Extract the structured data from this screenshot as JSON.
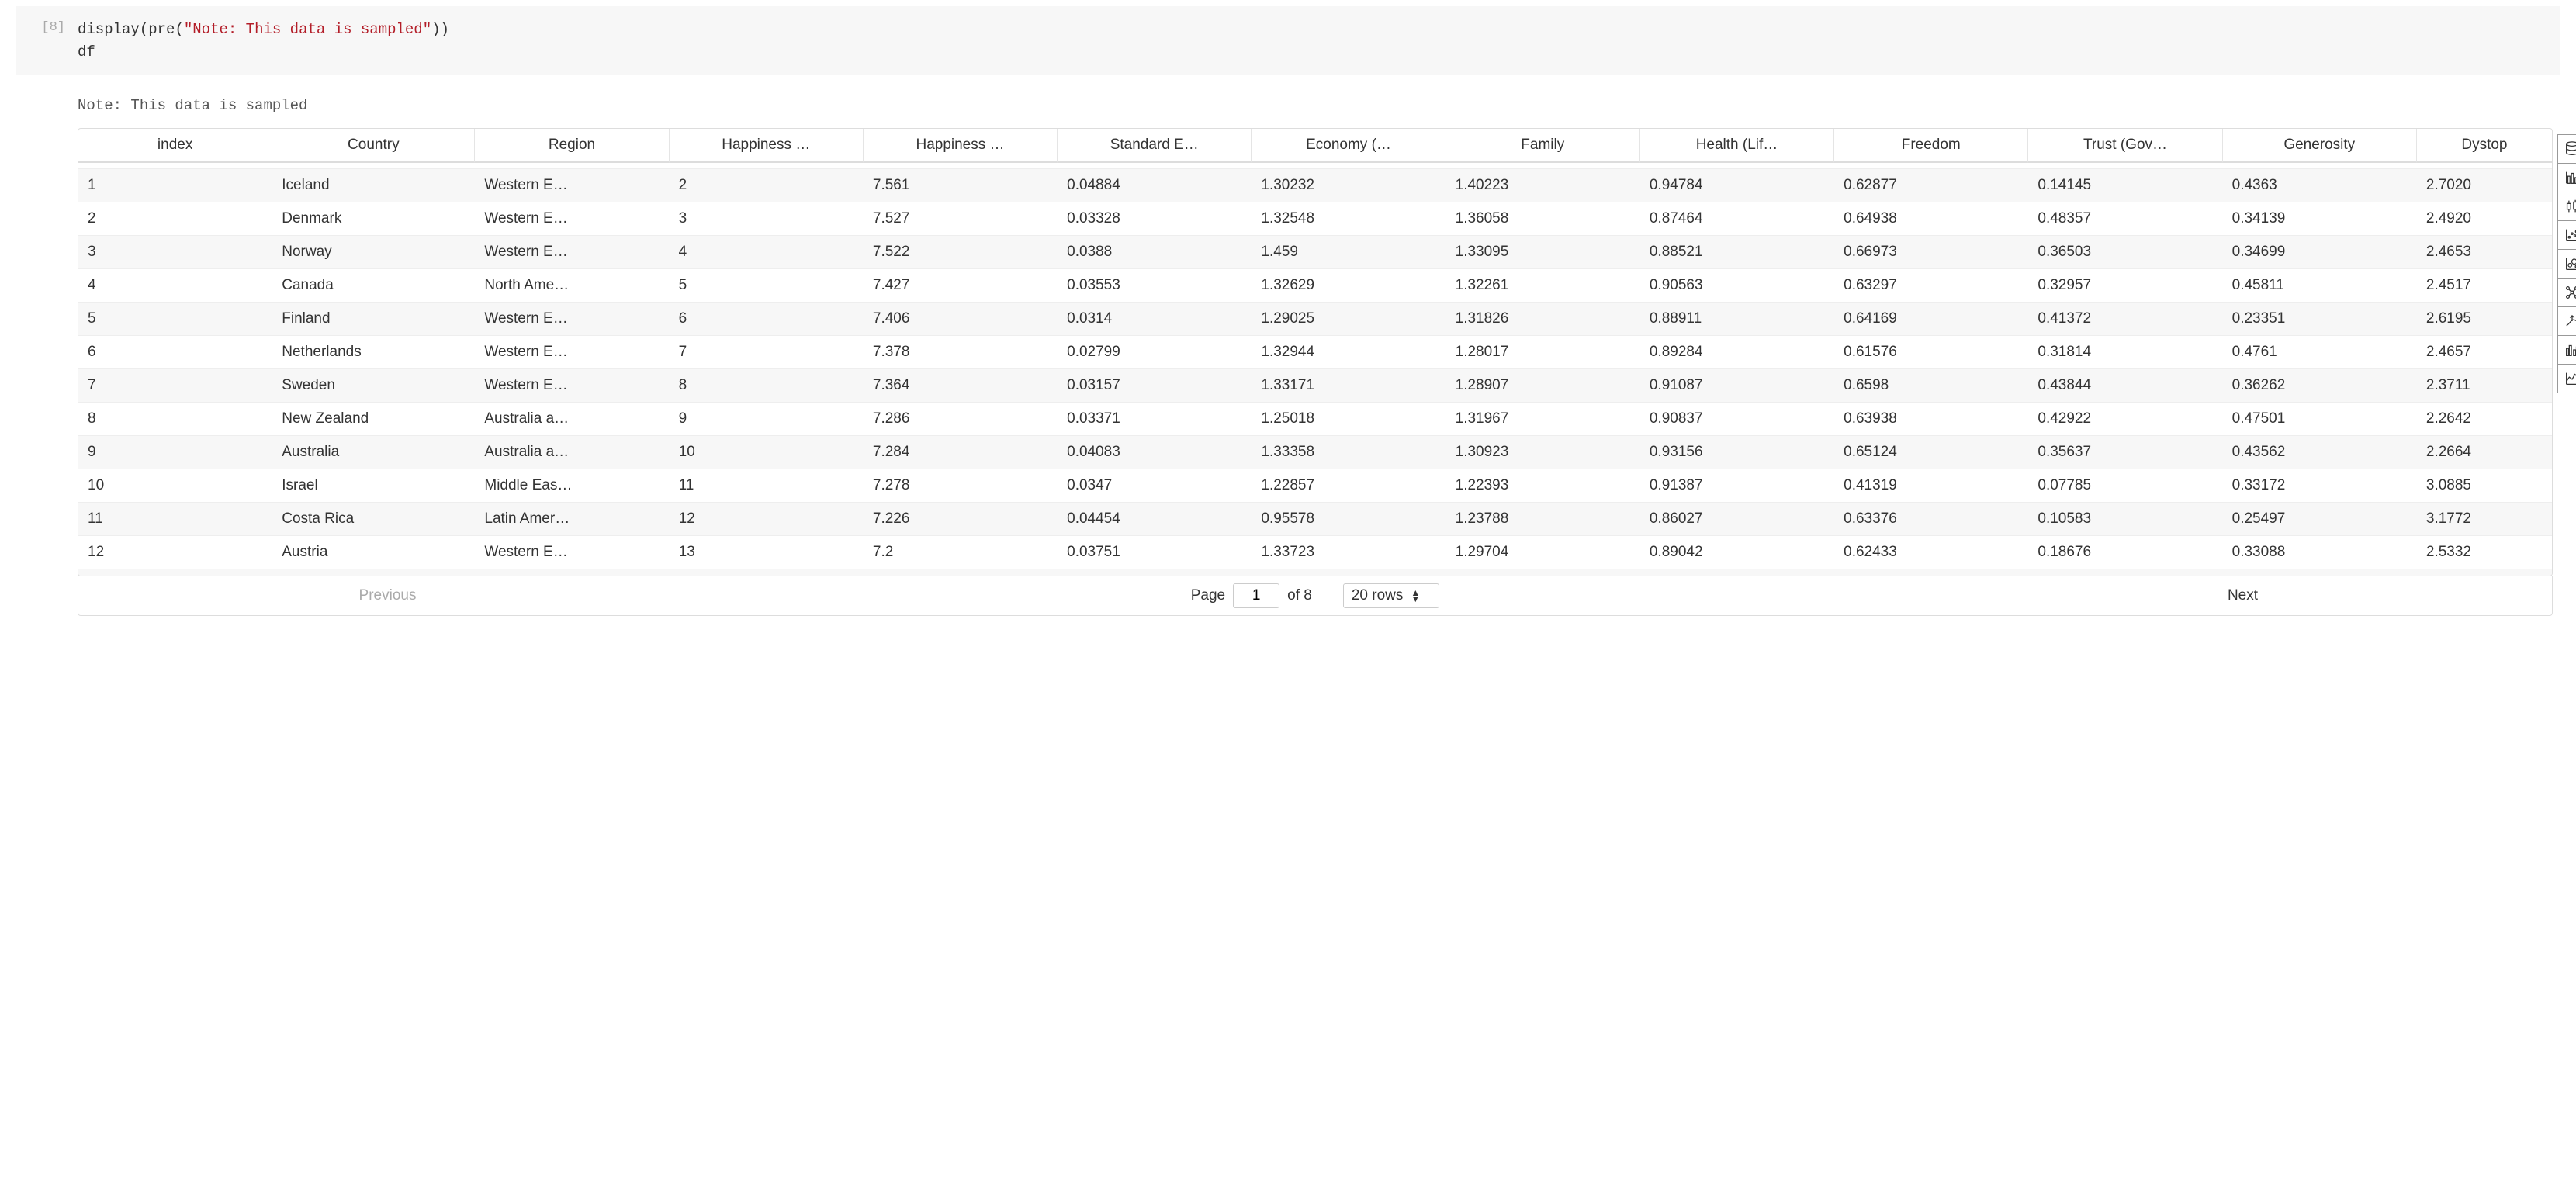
{
  "cell": {
    "prompt": "[8]",
    "code_display_fn": "display",
    "code_pre_fn": "pre",
    "code_open_paren": "(",
    "code_close_paren": ")",
    "code_string": "\"Note: This data is sampled\"",
    "code_line2": "df"
  },
  "output": {
    "note": "Note: This data is sampled"
  },
  "table": {
    "columns": [
      "index",
      "Country",
      "Region",
      "Happiness …",
      "Happiness …",
      "Standard E…",
      "Economy (…",
      "Family",
      "Health (Lif…",
      "Freedom",
      "Trust (Gov…",
      "Generosity",
      "Dystop"
    ],
    "rows": [
      [
        "1",
        "Iceland",
        "Western E…",
        "2",
        "7.561",
        "0.04884",
        "1.30232",
        "1.40223",
        "0.94784",
        "0.62877",
        "0.14145",
        "0.4363",
        "2.7020"
      ],
      [
        "2",
        "Denmark",
        "Western E…",
        "3",
        "7.527",
        "0.03328",
        "1.32548",
        "1.36058",
        "0.87464",
        "0.64938",
        "0.48357",
        "0.34139",
        "2.4920"
      ],
      [
        "3",
        "Norway",
        "Western E…",
        "4",
        "7.522",
        "0.0388",
        "1.459",
        "1.33095",
        "0.88521",
        "0.66973",
        "0.36503",
        "0.34699",
        "2.4653"
      ],
      [
        "4",
        "Canada",
        "North Ame…",
        "5",
        "7.427",
        "0.03553",
        "1.32629",
        "1.32261",
        "0.90563",
        "0.63297",
        "0.32957",
        "0.45811",
        "2.4517"
      ],
      [
        "5",
        "Finland",
        "Western E…",
        "6",
        "7.406",
        "0.0314",
        "1.29025",
        "1.31826",
        "0.88911",
        "0.64169",
        "0.41372",
        "0.23351",
        "2.6195"
      ],
      [
        "6",
        "Netherlands",
        "Western E…",
        "7",
        "7.378",
        "0.02799",
        "1.32944",
        "1.28017",
        "0.89284",
        "0.61576",
        "0.31814",
        "0.4761",
        "2.4657"
      ],
      [
        "7",
        "Sweden",
        "Western E…",
        "8",
        "7.364",
        "0.03157",
        "1.33171",
        "1.28907",
        "0.91087",
        "0.6598",
        "0.43844",
        "0.36262",
        "2.3711"
      ],
      [
        "8",
        "New Zealand",
        "Australia a…",
        "9",
        "7.286",
        "0.03371",
        "1.25018",
        "1.31967",
        "0.90837",
        "0.63938",
        "0.42922",
        "0.47501",
        "2.2642"
      ],
      [
        "9",
        "Australia",
        "Australia a…",
        "10",
        "7.284",
        "0.04083",
        "1.33358",
        "1.30923",
        "0.93156",
        "0.65124",
        "0.35637",
        "0.43562",
        "2.2664"
      ],
      [
        "10",
        "Israel",
        "Middle Eas…",
        "11",
        "7.278",
        "0.0347",
        "1.22857",
        "1.22393",
        "0.91387",
        "0.41319",
        "0.07785",
        "0.33172",
        "3.0885"
      ],
      [
        "11",
        "Costa Rica",
        "Latin Amer…",
        "12",
        "7.226",
        "0.04454",
        "0.95578",
        "1.23788",
        "0.86027",
        "0.63376",
        "0.10583",
        "0.25497",
        "3.1772"
      ],
      [
        "12",
        "Austria",
        "Western E…",
        "13",
        "7.2",
        "0.03751",
        "1.33723",
        "1.29704",
        "0.89042",
        "0.62433",
        "0.18676",
        "0.33088",
        "2.5332"
      ]
    ]
  },
  "pager": {
    "previous": "Previous",
    "next": "Next",
    "page_label": "Page",
    "page_value": "1",
    "of_text": "of 8",
    "rows_label": "20 rows"
  },
  "toolbar": {
    "icons": [
      "database",
      "bar-chart",
      "boxplot",
      "scatter",
      "bubble",
      "network",
      "upward",
      "grouped-bar",
      "line-chart"
    ]
  }
}
